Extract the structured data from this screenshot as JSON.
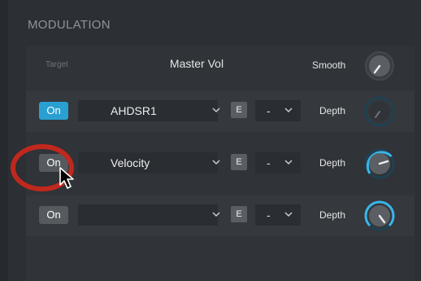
{
  "header": {
    "title": "MODULATION"
  },
  "target_row": {
    "target_label": "Target",
    "target_value": "Master Vol",
    "smooth_label": "Smooth"
  },
  "rows": [
    {
      "on_label": "On",
      "on_active": true,
      "source": "AHDSR1",
      "e_label": "E",
      "sub_value": "-",
      "depth_label": "Depth",
      "depth_level": 0.0
    },
    {
      "on_label": "On",
      "on_active": false,
      "source": "Velocity",
      "e_label": "E",
      "sub_value": "-",
      "depth_label": "Depth",
      "depth_level": 0.45
    },
    {
      "on_label": "On",
      "on_active": false,
      "source": "",
      "e_label": "E",
      "sub_value": "-",
      "depth_label": "Depth",
      "depth_level": 0.75
    }
  ],
  "icons": {
    "smooth_knob": "knob-icon",
    "depth_knob": "knob-icon",
    "dropdown": "chevron-down-icon",
    "cursor": "mouse-pointer-icon",
    "highlight": "red-circle-highlight"
  },
  "colors": {
    "accent": "#2a9fd1",
    "highlight": "#c0281e"
  }
}
